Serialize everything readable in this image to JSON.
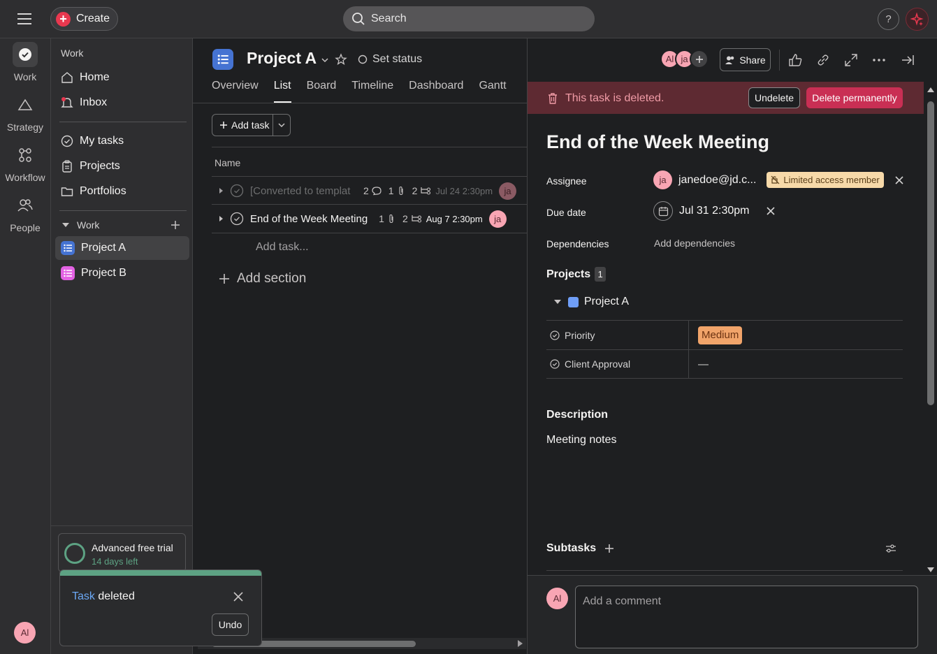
{
  "topbar": {
    "create_label": "Create",
    "search_placeholder": "Search",
    "help_label": "?"
  },
  "rail": {
    "items": [
      {
        "label": "Work",
        "icon": "check-circle-icon"
      },
      {
        "label": "Strategy",
        "icon": "triangle-icon"
      },
      {
        "label": "Workflow",
        "icon": "workflow-icon"
      },
      {
        "label": "People",
        "icon": "people-icon"
      }
    ],
    "user_initials": "Al"
  },
  "sidebar": {
    "section_label": "Work",
    "nav": [
      {
        "label": "Home",
        "icon": "home-icon"
      },
      {
        "label": "Inbox",
        "icon": "bell-icon"
      }
    ],
    "my_items": [
      {
        "label": "My tasks",
        "icon": "check-circle-icon"
      },
      {
        "label": "Projects",
        "icon": "clipboard-icon"
      },
      {
        "label": "Portfolios",
        "icon": "folder-icon"
      }
    ],
    "team": {
      "label": "Work",
      "projects": [
        {
          "label": "Project A",
          "color": "#4573d2",
          "active": true
        },
        {
          "label": "Project B",
          "color": "#e362e3",
          "active": false
        }
      ]
    },
    "trial": {
      "title": "Advanced free trial",
      "subtitle": "14 days left"
    }
  },
  "toast": {
    "link_text": "Task",
    "message": "deleted",
    "undo_label": "Undo"
  },
  "main": {
    "project_title": "Project A",
    "set_status_label": "Set status",
    "tabs": [
      {
        "label": "Overview",
        "active": false
      },
      {
        "label": "List",
        "active": true
      },
      {
        "label": "Board",
        "active": false
      },
      {
        "label": "Timeline",
        "active": false
      },
      {
        "label": "Dashboard",
        "active": false
      },
      {
        "label": "Gantt",
        "active": false
      }
    ],
    "add_task_label": "Add task",
    "name_column": "Name",
    "tasks": [
      {
        "name": "[Converted to templat",
        "comments": "2",
        "attachments": "1",
        "subtasks": "2",
        "due": "Jul 24 2:30pm",
        "assignee": "ja",
        "muted": true
      },
      {
        "name": "End of the Week Meeting",
        "comments": "",
        "attachments": "1",
        "subtasks": "2",
        "due": "Aug 7 2:30pm",
        "assignee": "ja",
        "muted": false
      }
    ],
    "add_task_inline": "Add task...",
    "add_section_label": "Add section"
  },
  "detail": {
    "collaborators": [
      "Al",
      "ja"
    ],
    "share_label": "Share",
    "deleted_banner": {
      "message": "This task is deleted.",
      "undelete_label": "Undelete",
      "delete_perm_label": "Delete permanently"
    },
    "title": "End of the Week Meeting",
    "fields": {
      "assignee_label": "Assignee",
      "assignee_initials": "ja",
      "assignee_name": "janedoe@jd.c...",
      "assignee_badge": "Limited access member",
      "due_label": "Due date",
      "due_value": "Jul 31 2:30pm",
      "dependencies_label": "Dependencies",
      "add_dependencies": "Add dependencies"
    },
    "projects": {
      "label": "Projects",
      "count": "1",
      "items": [
        {
          "label": "Project A",
          "color": "#6f9ef7"
        }
      ]
    },
    "custom_fields": [
      {
        "name": "Priority",
        "value": "Medium",
        "chip_color": "#f1a46a"
      },
      {
        "name": "Client Approval",
        "value": "—"
      }
    ],
    "description": {
      "label": "Description",
      "text": "Meeting notes"
    },
    "subtasks_label": "Subtasks",
    "comment": {
      "user_initials": "Al",
      "placeholder": "Add a comment"
    }
  }
}
